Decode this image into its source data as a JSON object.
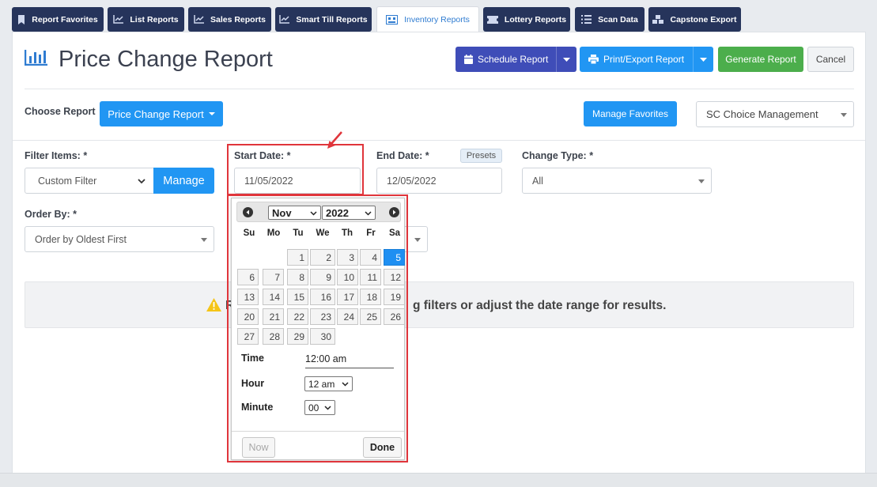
{
  "tabs": [
    {
      "label": "Report Favorites",
      "icon": "bookmark-icon"
    },
    {
      "label": "List Reports",
      "icon": "line-chart-icon"
    },
    {
      "label": "Sales Reports",
      "icon": "line-chart-icon"
    },
    {
      "label": "Smart Till Reports",
      "icon": "line-chart-icon"
    },
    {
      "label": "Inventory Reports",
      "icon": "inventory-icon",
      "active": true
    },
    {
      "label": "Lottery Reports",
      "icon": "ticket-icon"
    },
    {
      "label": "Scan Data",
      "icon": "list-icon"
    },
    {
      "label": "Capstone Export",
      "icon": "cubes-icon"
    }
  ],
  "header": {
    "title": "Price Change Report",
    "schedule_label": "Schedule Report",
    "print_label": "Print/Export Report",
    "generate_label": "Generate Report",
    "cancel_label": "Cancel"
  },
  "choose": {
    "label": "Choose Report",
    "report_button": "Price Change Report",
    "favorites_button": "Manage Favorites",
    "company": "SC Choice Management"
  },
  "filters": {
    "filter_items_label": "Filter Items: *",
    "filter_items_value": "Custom Filter",
    "manage_button": "Manage",
    "start_date_label": "Start Date: *",
    "start_date_value": "11/05/2022",
    "end_date_label": "End Date: *",
    "presets_label": "Presets",
    "end_date_value": "12/05/2022",
    "change_type_label": "Change Type: *",
    "change_type_value": "All",
    "order_by_label": "Order By: *",
    "order_by_value": "Order by Oldest First"
  },
  "alert": {
    "text_left": "R",
    "text_right": "g filters or adjust the date range for results."
  },
  "datepicker": {
    "month": "Nov",
    "year": "2022",
    "weekdays": [
      "Su",
      "Mo",
      "Tu",
      "We",
      "Th",
      "Fr",
      "Sa"
    ],
    "days": [
      "1",
      "2",
      "3",
      "4",
      "5",
      "6",
      "7",
      "8",
      "9",
      "10",
      "11",
      "12",
      "13",
      "14",
      "15",
      "16",
      "17",
      "18",
      "19",
      "20",
      "21",
      "22",
      "23",
      "24",
      "25",
      "26",
      "27",
      "28",
      "29",
      "30"
    ],
    "selected_day": "5",
    "time_label": "Time",
    "time_value": "12:00 am",
    "hour_label": "Hour",
    "hour_value": "12 am",
    "minute_label": "Minute",
    "minute_value": "00",
    "now_button": "Now",
    "done_button": "Done"
  },
  "colors": {
    "tab_bg": "#26345b",
    "primary": "#2196f3",
    "schedule": "#3f4db8",
    "generate": "#4cae4c",
    "highlight": "#e0353b"
  }
}
